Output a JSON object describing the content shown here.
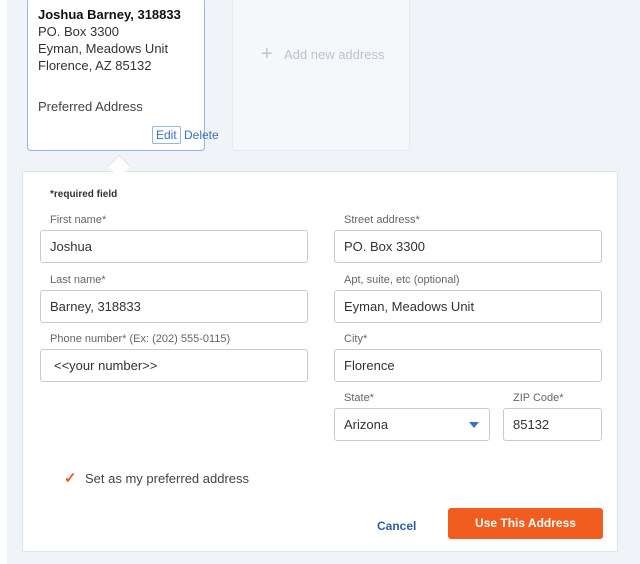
{
  "address_card": {
    "name": "Joshua Barney, 318833",
    "line1": "PO. Box 3300",
    "line2": "Eyman, Meadows Unit",
    "line3": "Florence, AZ 85132",
    "preferred": "Preferred Address",
    "edit_label": "Edit",
    "delete_label": "Delete"
  },
  "add_new": {
    "label": "Add new address"
  },
  "form": {
    "required_note": "*required field",
    "first_name": {
      "label": "First name*",
      "value": "Joshua"
    },
    "last_name": {
      "label": "Last name*",
      "value": "Barney, 318833"
    },
    "phone": {
      "label": "Phone number* (Ex: (202) 555-0115)",
      "value": "<<your number>>"
    },
    "street": {
      "label": "Street address*",
      "value": "PO. Box 3300"
    },
    "apt": {
      "label": "Apt, suite, etc (optional)",
      "value": "Eyman, Meadows Unit"
    },
    "city": {
      "label": "City*",
      "value": "Florence"
    },
    "state": {
      "label": "State*",
      "value": "Arizona"
    },
    "zip": {
      "label": "ZIP Code*",
      "value": "85132"
    },
    "preferred_checkbox": {
      "label": "Set as my preferred address",
      "checked": true
    },
    "cancel_label": "Cancel",
    "submit_label": "Use This Address"
  },
  "colors": {
    "accent": "#f05d1e",
    "link": "#3d6fbf",
    "card_border": "#8fb7e0"
  }
}
